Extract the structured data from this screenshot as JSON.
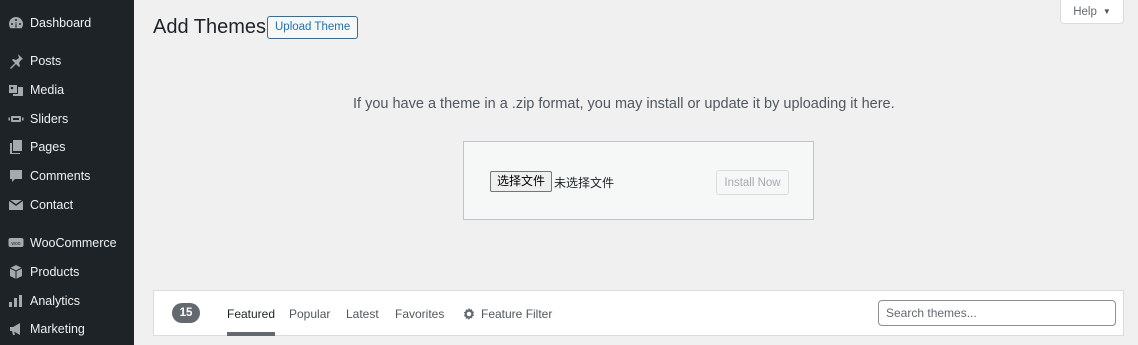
{
  "sidebar": {
    "items": [
      {
        "label": "Dashboard",
        "icon": "dashboard-icon"
      },
      {
        "label": "Posts",
        "icon": "pin-icon"
      },
      {
        "label": "Media",
        "icon": "media-icon"
      },
      {
        "label": "Sliders",
        "icon": "slider-icon"
      },
      {
        "label": "Pages",
        "icon": "pages-icon"
      },
      {
        "label": "Comments",
        "icon": "comment-icon"
      },
      {
        "label": "Contact",
        "icon": "mail-icon"
      },
      {
        "label": "WooCommerce",
        "icon": "woo-icon"
      },
      {
        "label": "Products",
        "icon": "box-icon"
      },
      {
        "label": "Analytics",
        "icon": "bar-chart-icon"
      },
      {
        "label": "Marketing",
        "icon": "megaphone-icon"
      }
    ]
  },
  "header": {
    "title": "Add Themes",
    "upload_button": "Upload Theme",
    "help_label": "Help",
    "help_arrow": "▼"
  },
  "upload": {
    "description": "If you have a theme in a .zip format, you may install or update it by uploading it here.",
    "choose_file_label": "选择文件",
    "file_status": "未选择文件",
    "install_button": "Install Now"
  },
  "filters": {
    "count": "15",
    "links": [
      "Featured",
      "Popular",
      "Latest",
      "Favorites"
    ],
    "feature_filter": "Feature Filter",
    "search_placeholder": "Search themes..."
  }
}
